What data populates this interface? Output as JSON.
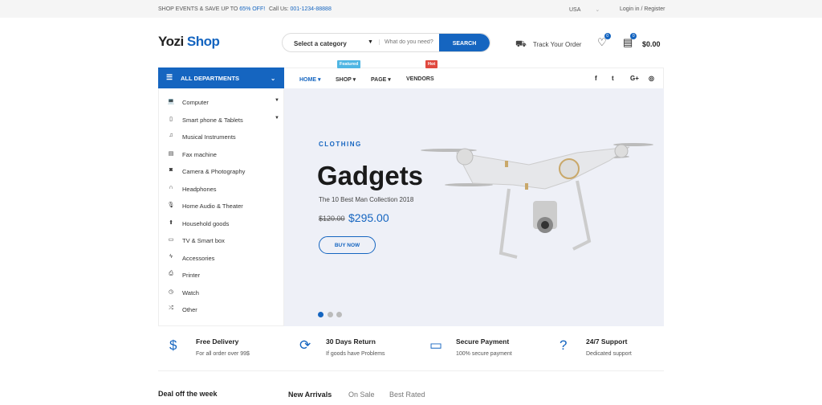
{
  "topbar": {
    "promo_prefix": "SHOP EVENTS & SAVE UP TO ",
    "promo_highlight": "65% OFF!",
    "call_label": "Call Us: ",
    "phone": "001-1234-88888",
    "country": "USA",
    "login": "Login in / Register"
  },
  "header": {
    "logo_a": "Yozi",
    "logo_b": "Shop",
    "category": "Select a category",
    "search_placeholder": "What do you need?",
    "search_button": "SEARCH",
    "track": "Track Your Order",
    "wishlist_count": "0",
    "cart_count": "0",
    "cart_total": "$0.00"
  },
  "nav": {
    "departments": "ALL DEPARTMENTS",
    "items": [
      {
        "label": "HOME ▾"
      },
      {
        "label": "SHOP ▾",
        "tag": "Featured"
      },
      {
        "label": "PAGE ▾"
      },
      {
        "label": "VENDORS",
        "tag": "Hot"
      }
    ],
    "social": [
      "f",
      "t",
      "G+",
      "◎"
    ]
  },
  "sidebar": {
    "items": [
      {
        "label": "Computer",
        "icon": "💻"
      },
      {
        "label": "Smart phone & Tablets",
        "icon": "▯"
      },
      {
        "label": "Musical Instruments",
        "icon": "♫"
      },
      {
        "label": "Fax machine",
        "icon": "▤"
      },
      {
        "label": "Camera & Photography",
        "icon": "◙"
      },
      {
        "label": "Headphones",
        "icon": "∩"
      },
      {
        "label": "Home Audio & Theater",
        "icon": "🎙"
      },
      {
        "label": "Household goods",
        "icon": "⬆"
      },
      {
        "label": "TV & Smart box",
        "icon": "▭"
      },
      {
        "label": "Accessories",
        "icon": "ϟ"
      },
      {
        "label": "Printer",
        "icon": "⎙"
      },
      {
        "label": "Watch",
        "icon": "◷"
      },
      {
        "label": "Other",
        "icon": "⤮"
      }
    ]
  },
  "banner": {
    "kicker": "CLOTHING",
    "title": "Gadgets",
    "subtitle": "The 10 Best Man Collection 2018",
    "old_price": "$120.00",
    "price": "$295.00",
    "button": "BUY NOW",
    "active_slide": 1,
    "slides": 3
  },
  "features": [
    {
      "title": "Free Delivery",
      "sub": "For all order over 99$",
      "icon": "$"
    },
    {
      "title": "30 Days Return",
      "sub": "If goods have Problems",
      "icon": "⟳"
    },
    {
      "title": "Secure Payment",
      "sub": "100% secure payment",
      "icon": "▭"
    },
    {
      "title": "24/7 Support",
      "sub": "Dedicated support",
      "icon": "?"
    }
  ],
  "bottom": {
    "deal": "Deal off the week",
    "tabs": [
      "New Arrivals",
      "On Sale",
      "Best Rated"
    ]
  },
  "colors": {
    "primary": "#1565c0",
    "featured": "#4fb6e3",
    "hot": "#e0483e"
  }
}
